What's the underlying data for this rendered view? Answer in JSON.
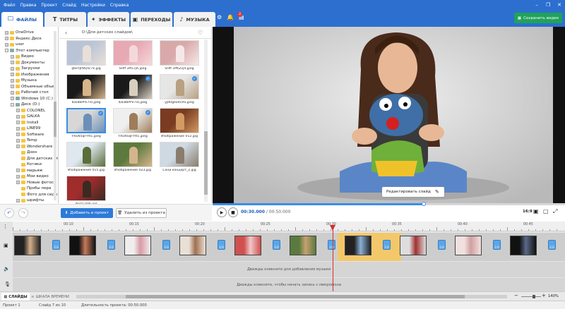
{
  "menu": [
    "Файл",
    "Правка",
    "Проект",
    "Слайд",
    "Настройки",
    "Справка"
  ],
  "window": {
    "minimize": "–",
    "maximize": "❐",
    "close": "✕"
  },
  "tabs": [
    {
      "label": "ФАЙЛЫ",
      "icon": "🗀"
    },
    {
      "label": "ТИТРЫ",
      "icon": "T"
    },
    {
      "label": "ЭФФЕКТЫ",
      "icon": "✦"
    },
    {
      "label": "ПЕРЕХОДЫ",
      "icon": "▣"
    },
    {
      "label": "МУЗЫКА",
      "icon": "♪"
    }
  ],
  "header": {
    "save_label": "Сохранить видео",
    "notif_count": "2"
  },
  "tree": [
    {
      "label": "OneDrive",
      "indent": 0,
      "type": "folder",
      "toggle": "+"
    },
    {
      "label": "Яндекс.Диск",
      "indent": 0,
      "type": "folder",
      "toggle": "+"
    },
    {
      "label": "user",
      "indent": 0,
      "type": "folder",
      "toggle": "+"
    },
    {
      "label": "Этот компьютер",
      "indent": 0,
      "type": "device",
      "toggle": "−"
    },
    {
      "label": "Видео",
      "indent": 1,
      "type": "folder",
      "toggle": "+"
    },
    {
      "label": "Документы",
      "indent": 1,
      "type": "folder",
      "toggle": "+"
    },
    {
      "label": "Загрузки",
      "indent": 1,
      "type": "folder",
      "toggle": "+"
    },
    {
      "label": "Изображения",
      "indent": 1,
      "type": "folder",
      "toggle": "+"
    },
    {
      "label": "Музыка",
      "indent": 1,
      "type": "folder",
      "toggle": "+"
    },
    {
      "label": "Объемные объе",
      "indent": 1,
      "type": "folder",
      "toggle": "+"
    },
    {
      "label": "Рабочий стол",
      "indent": 1,
      "type": "folder",
      "toggle": "+"
    },
    {
      "label": "Windows 10 (C:)",
      "indent": 1,
      "type": "device",
      "toggle": "+"
    },
    {
      "label": "Диск (D:)",
      "indent": 1,
      "type": "device",
      "toggle": "−"
    },
    {
      "label": "COLONEL",
      "indent": 2,
      "type": "folder",
      "toggle": "+"
    },
    {
      "label": "GALKA",
      "indent": 2,
      "type": "folder",
      "toggle": "+"
    },
    {
      "label": "Install",
      "indent": 2,
      "type": "folder",
      "toggle": "+"
    },
    {
      "label": "LINE99",
      "indent": 2,
      "type": "folder",
      "toggle": "+"
    },
    {
      "label": "Software",
      "indent": 2,
      "type": "folder",
      "toggle": "+"
    },
    {
      "label": "Temp",
      "indent": 2,
      "type": "folder",
      "toggle": "+"
    },
    {
      "label": "Wondershare",
      "indent": 2,
      "type": "folder",
      "toggle": "+"
    },
    {
      "label": "Дзен",
      "indent": 2,
      "type": "folder",
      "toggle": ""
    },
    {
      "label": "Для детских сл",
      "indent": 2,
      "type": "folder",
      "toggle": ""
    },
    {
      "label": "Котики",
      "indent": 2,
      "type": "folder",
      "toggle": ""
    },
    {
      "label": "марьяж",
      "indent": 2,
      "type": "folder",
      "toggle": "+"
    },
    {
      "label": "Мои видео",
      "indent": 2,
      "type": "folder",
      "toggle": "+"
    },
    {
      "label": "Новые фотосе",
      "indent": 2,
      "type": "folder",
      "toggle": "+"
    },
    {
      "label": "Пробы пера",
      "indent": 2,
      "type": "folder",
      "toggle": ""
    },
    {
      "label": "Фото для сиды",
      "indent": 2,
      "type": "folder",
      "toggle": ""
    },
    {
      "label": "шрифты",
      "indent": 2,
      "type": "folder",
      "toggle": "+"
    }
  ],
  "browser": {
    "path": "D:\\Для детских слайдов\\",
    "thumbs": [
      {
        "caption": "q6eYJP8Qlic7k.jpg",
        "colors": [
          "#b9c4d6",
          "#e8e0d8"
        ],
        "selected": false,
        "checked": false
      },
      {
        "caption": "SHff 3PlCrjA.jpeg",
        "colors": [
          "#e7a9b4",
          "#f4d9d9"
        ],
        "selected": false,
        "checked": false
      },
      {
        "caption": "SHff 3PKZvj4.jpeg",
        "colors": [
          "#d9a9a9",
          "#f6e8e8"
        ],
        "selected": false,
        "checked": false
      },
      {
        "caption": "IDE8bPPx7ro.jpeg",
        "colors": [
          "#1a1a1a",
          "#d7b48a"
        ],
        "selected": false,
        "checked": false
      },
      {
        "caption": "IDE8bPPx7ro.jpeg",
        "colors": [
          "#1a1a1a",
          "#d9cfc0"
        ],
        "selected": false,
        "checked": true
      },
      {
        "caption": "yJd0geoRcRS.jpeg",
        "colors": [
          "#e6e6e6",
          "#b8a082"
        ],
        "selected": false,
        "checked": true
      },
      {
        "caption": "YXEN5qFYtt1.jpeg",
        "colors": [
          "#d7d7d7",
          "#6c8fb8"
        ],
        "selected": true,
        "checked": true
      },
      {
        "caption": "YXEN5qFYtt1.jpeg",
        "colors": [
          "#efefef",
          "#9d7d5a"
        ],
        "selected": false,
        "checked": true
      },
      {
        "caption": "Изображение 012.jpg",
        "colors": [
          "#7a3b21",
          "#d39a63"
        ],
        "selected": false,
        "checked": false
      },
      {
        "caption": "Изображение 015.jpg",
        "colors": [
          "#dfe8ef",
          "#5a6e3b"
        ],
        "selected": false,
        "checked": false
      },
      {
        "caption": "Изображение 023.jpg",
        "colors": [
          "#5c7a3e",
          "#d6b58c"
        ],
        "selected": false,
        "checked": false
      },
      {
        "caption": "Сани концерт_2.jpg",
        "colors": [
          "#cfd9e2",
          "#8a7d6e"
        ],
        "selected": false,
        "checked": false
      },
      {
        "caption": "фото 006.jpg",
        "colors": [
          "#a02c2c",
          "#3b2a22"
        ],
        "selected": false,
        "checked": false
      }
    ]
  },
  "lower": {
    "add_label": "Добавить в проект",
    "delete_label": "Удалить из проекта"
  },
  "preview": {
    "edit_slide_label": "Редактировать слайд",
    "time_current": "00:30.000",
    "time_total": "00:50.000",
    "time_sep": "/",
    "aspect": "16:9",
    "progress": 0.6
  },
  "ruler": {
    "marks": [
      "00:10",
      "00:15",
      "00:20",
      "00:25",
      "00:30",
      "00:35",
      "00:40",
      "00:45"
    ],
    "playhead": "00:30"
  },
  "timeline": {
    "music_hint": "Дважды кликните для добавления музыки",
    "voice_hint": "Дважды кликните, чтобы начать запись с микрофона",
    "slides_tab": "СЛАЙДЫ",
    "timeline_tab": "ШКАЛА ВРЕМЕНИ",
    "zoom": "140%",
    "clips": [
      {
        "colors": [
          "#222",
          "#d4b08c"
        ],
        "dur": "2.0"
      },
      {
        "colors": [
          "#111",
          "#c87a5a"
        ],
        "dur": "2.0"
      },
      {
        "colors": [
          "#eee",
          "#d99aa4"
        ],
        "dur": "2.0"
      },
      {
        "colors": [
          "#e9e0d5",
          "#a07050"
        ],
        "dur": "2.0"
      },
      {
        "colors": [
          "#d05050",
          "#f0c8c8"
        ],
        "dur": "2.0"
      },
      {
        "colors": [
          "#5a7a3e",
          "#c8a070"
        ],
        "dur": "2.0"
      },
      {
        "colors": [
          "#222",
          "#8ab0d8"
        ],
        "dur": "2.0"
      },
      {
        "colors": [
          "#ddd",
          "#a03030"
        ],
        "dur": "2.0"
      },
      {
        "colors": [
          "#f0e0e0",
          "#d0a0a0"
        ],
        "dur": "2.0"
      },
      {
        "colors": [
          "#111",
          "#5a6a8a"
        ],
        "dur": "2.0"
      }
    ]
  },
  "status": {
    "project": "Проект 1",
    "slide": "Слайд 7 из 10",
    "duration": "Длительность проекта: 00:50.000"
  },
  "colors": {
    "accent": "#2d6fcf",
    "save": "#20a25a",
    "selected_clip": "#f3c86a",
    "playhead": "#d32f2f"
  }
}
